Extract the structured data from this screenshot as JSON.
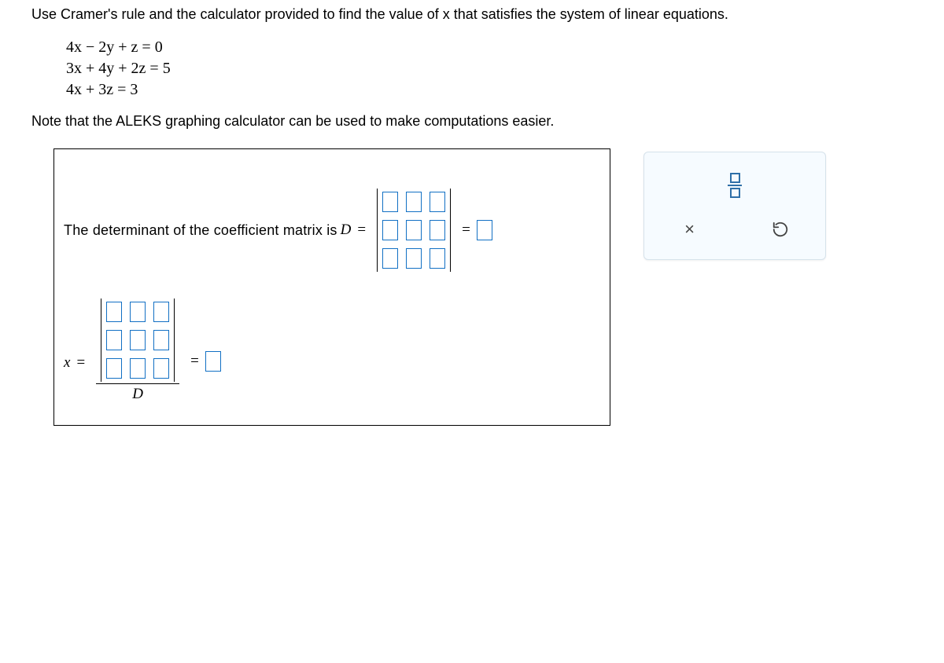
{
  "instruction": "Use Cramer's rule and the calculator provided to find the value of x that satisfies the system of linear equations.",
  "equations": {
    "line1": "4x − 2y + z = 0",
    "line2": "3x + 4y + 2z = 5",
    "line3": "4x + 3z = 3"
  },
  "note": "Note that the ALEKS graphing calculator can be used to make computations easier.",
  "workbox": {
    "d_label": "The determinant of the coefficient matrix is  ",
    "d_var": "D",
    "eq": "=",
    "x_var": "x",
    "x_denom": "D"
  },
  "tools": {
    "fraction": "fraction-tool",
    "clear": "×",
    "reset": "reset"
  }
}
